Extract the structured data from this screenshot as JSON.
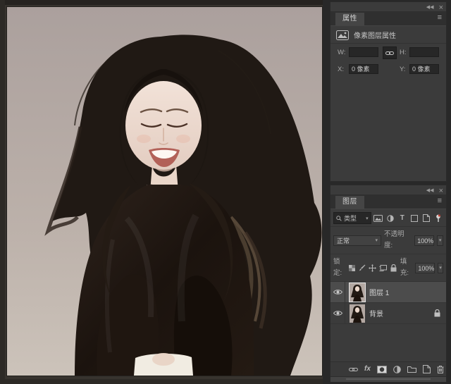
{
  "window": {
    "collapse_icon": "◀◀",
    "close_icon": "×",
    "menu_icon": "≡",
    "chevron_down": "▾"
  },
  "properties_panel": {
    "tab_label": "属性",
    "type_row_label": "像素图层属性",
    "dims": {
      "w_label": "W:",
      "w_value": "",
      "h_label": "H:",
      "h_value": ""
    },
    "pos": {
      "x_label": "X:",
      "x_value": "0 像素",
      "y_label": "Y:",
      "y_value": "0 像素"
    }
  },
  "layers_panel": {
    "tab_label": "图层",
    "filter": {
      "kind_label": "类型",
      "text_tool_glyph": "T"
    },
    "blend": {
      "mode": "正常",
      "opacity_label": "不透明度:",
      "opacity_value": "100%"
    },
    "lock": {
      "label": "锁定:",
      "fill_label": "填充:",
      "fill_value": "100%"
    },
    "layers": [
      {
        "name": "图层 1",
        "selected": true
      },
      {
        "name": "背景",
        "locked": true
      }
    ],
    "footer": {
      "fx_label": "fx"
    }
  },
  "canvas": {
    "alt": "portrait photo: young woman, long dark wavy hair, eyes closed, smiling, dark satin blouse, white skirt, warm gray studio background"
  },
  "colors": {
    "photo_background": "#b1a6a1",
    "hair": "#201914",
    "panel_bg": "#3b3b3b",
    "selected_row": "#4c4c4c",
    "app_bg": "#37332e"
  }
}
